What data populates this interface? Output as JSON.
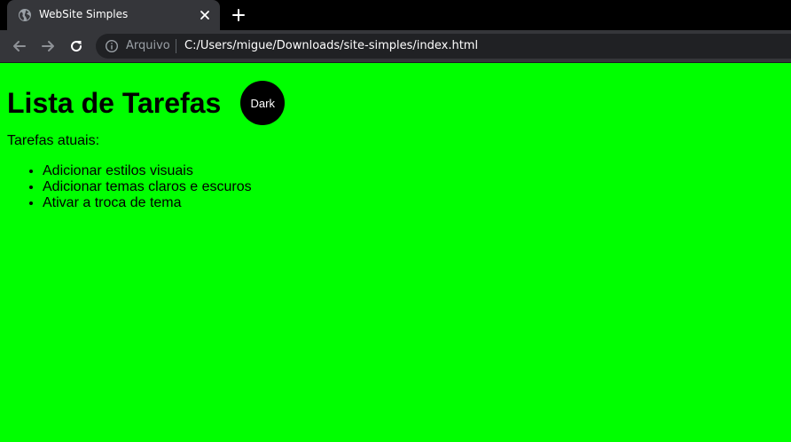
{
  "browser": {
    "tab": {
      "title": "WebSite Simples",
      "favicon": "globe-icon"
    },
    "toolbar": {
      "back_icon": "arrow-left-icon",
      "forward_icon": "arrow-right-icon",
      "reload_icon": "reload-icon",
      "security_icon": "info-icon",
      "security_label": "Arquivo",
      "url": "C:/Users/migue/Downloads/site-simples/index.html"
    },
    "colors": {
      "tabstrip_bg": "#000000",
      "toolbar_bg": "#35363a",
      "omnibox_bg": "#202124"
    }
  },
  "page": {
    "background": "#00ff00",
    "title": "Lista de Tarefas",
    "theme_button_label": "Dark",
    "tasks_label": "Tarefas atuais:",
    "tasks": [
      "Adicionar estilos visuais",
      "Adicionar temas claros e escuros",
      "Ativar a troca de tema"
    ]
  }
}
